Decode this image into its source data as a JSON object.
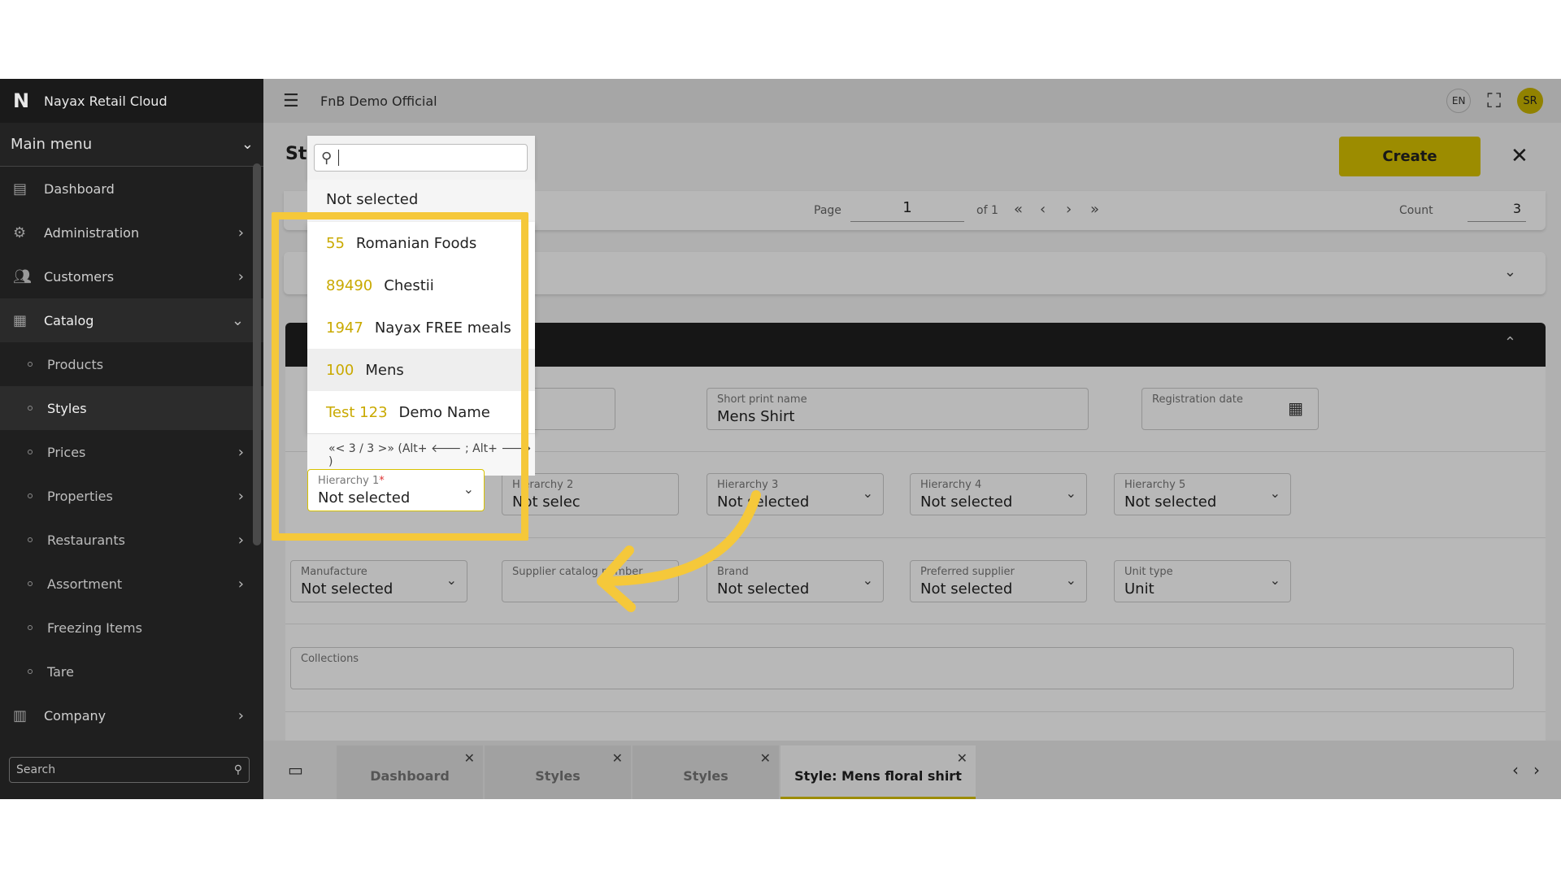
{
  "brand": {
    "logo": "N",
    "name": "Nayax Retail Cloud"
  },
  "sidebar": {
    "main_menu": "Main menu",
    "items": [
      {
        "label": "Dashboard",
        "icon": "dashboard-icon"
      },
      {
        "label": "Administration",
        "icon": "gear-icon"
      },
      {
        "label": "Customers",
        "icon": "users-icon"
      },
      {
        "label": "Catalog",
        "icon": "catalog-icon"
      }
    ],
    "catalog_children": [
      "Products",
      "Styles",
      "Prices",
      "Properties",
      "Restaurants",
      "Assortment",
      "Freezing Items",
      "Tare"
    ],
    "company": "Company",
    "search_placeholder": "Search"
  },
  "topbar": {
    "title": "FnB Demo Official",
    "lang": "EN",
    "user_initials": "SR"
  },
  "page": {
    "title": "St",
    "create_label": "Create",
    "pager": {
      "page_label": "Page",
      "page_value": "1",
      "of_label": "of 1",
      "count_label": "Count",
      "count_value": "3"
    }
  },
  "form": {
    "short_print_label": "Short print name",
    "short_print_value": "Mens Shirt",
    "registration_label": "Registration date",
    "hierarchy2_label": "Hierarchy 2",
    "hierarchy3_label": "Hierarchy 3",
    "hierarchy4_label": "Hierarchy 4",
    "hierarchy5_label": "Hierarchy 5",
    "hierarchy_value": "Not selected",
    "hierarchy2_visible": "Not selec",
    "manufacture_label": "Manufacture",
    "manufacture_value": "Not selected",
    "supplier_catalog_label": "Supplier catalog number",
    "brand_label": "Brand",
    "brand_value": "Not selected",
    "preferred_supplier_label": "Preferred supplier",
    "preferred_supplier_value": "Not selected",
    "unit_type_label": "Unit type",
    "unit_type_value": "Unit",
    "collections_label": "Collections"
  },
  "dropdown": {
    "search_value": "",
    "not_selected": "Not selected",
    "items": [
      {
        "code": "55",
        "name": "Romanian Foods"
      },
      {
        "code": "89490",
        "name": "Chestii"
      },
      {
        "code": "1947",
        "name": "Nayax FREE meals"
      },
      {
        "code": "100",
        "name": "Mens"
      },
      {
        "code": "Test 123",
        "name": "Demo Name"
      }
    ],
    "pager_text": "«<  3 / 3  >»  (Alt+ 🡐 ; Alt+ 🡒 )",
    "field_label": "Hierarchy 1",
    "field_required": "*",
    "field_value": "Not selected"
  },
  "tabs": [
    {
      "label": "Dashboard"
    },
    {
      "label": "Styles"
    },
    {
      "label": "Styles"
    },
    {
      "label": "Style: Mens floral shirt"
    }
  ],
  "colors": {
    "accent": "#d8c200",
    "highlight": "#f5c83a",
    "sidebar_bg": "#1f1f1f"
  }
}
